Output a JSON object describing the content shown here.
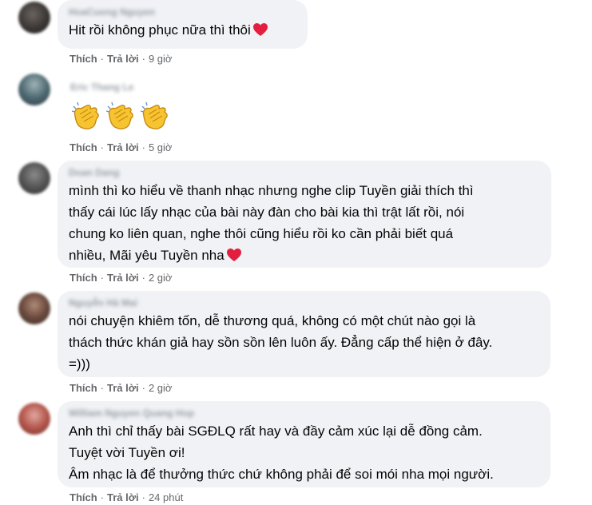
{
  "comments": [
    {
      "author": "HoaCuong Nguyen",
      "lines": [
        "Hit rồi không phục nữa thì thôi"
      ],
      "actions": {
        "like": "Thích",
        "reply": "Trả lời",
        "time": "9 giờ"
      }
    },
    {
      "author": "Eric Thang Le",
      "lines": [],
      "emoji": [
        "clapping-hands",
        "clapping-hands",
        "clapping-hands"
      ],
      "actions": {
        "like": "Thích",
        "reply": "Trả lời",
        "time": "5 giờ"
      }
    },
    {
      "author": "Doan Dang",
      "lines": [
        "mình thì ko hiểu về thanh nhạc nhưng nghe clip Tuyền giải thích thì",
        "thấy cái lúc lấy nhạc của bài này đàn cho bài kia thì trật lất rồi, nói",
        "chung ko liên quan, nghe thôi cũng hiểu rồi ko cần phải biết quá",
        "nhiều, Mãi yêu Tuyền nha"
      ],
      "actions": {
        "like": "Thích",
        "reply": "Trả lời",
        "time": "2 giờ"
      }
    },
    {
      "author": "Nguyễn Hà Mai",
      "lines": [
        "nói chuyện khiêm tốn, dễ thương quá, không có một chút nào gọi là",
        "thách thức khán giả hay sồn sồn lên luôn ấy. Đẳng cấp thể hiện ở đây.",
        "=)))"
      ],
      "actions": {
        "like": "Thích",
        "reply": "Trả lời",
        "time": "2 giờ"
      }
    },
    {
      "author": "William Nguyen Quang Hop",
      "lines": [
        "Anh thì chỉ thấy bài SGĐLQ rất hay và đầy cảm xúc lại dễ đồng cảm.",
        "Tuyệt vời Tuyền ơi!",
        "Âm nhạc là để thưởng thức chứ không phải để soi mói nha mọi người."
      ],
      "actions": {
        "like": "Thích",
        "reply": "Trả lời",
        "time": "24 phút"
      }
    }
  ],
  "colors": {
    "bubble": "#f0f2f5",
    "text": "#050505",
    "meta": "#65676b",
    "heart": "#e41e3f",
    "clap": "#f7c431"
  }
}
